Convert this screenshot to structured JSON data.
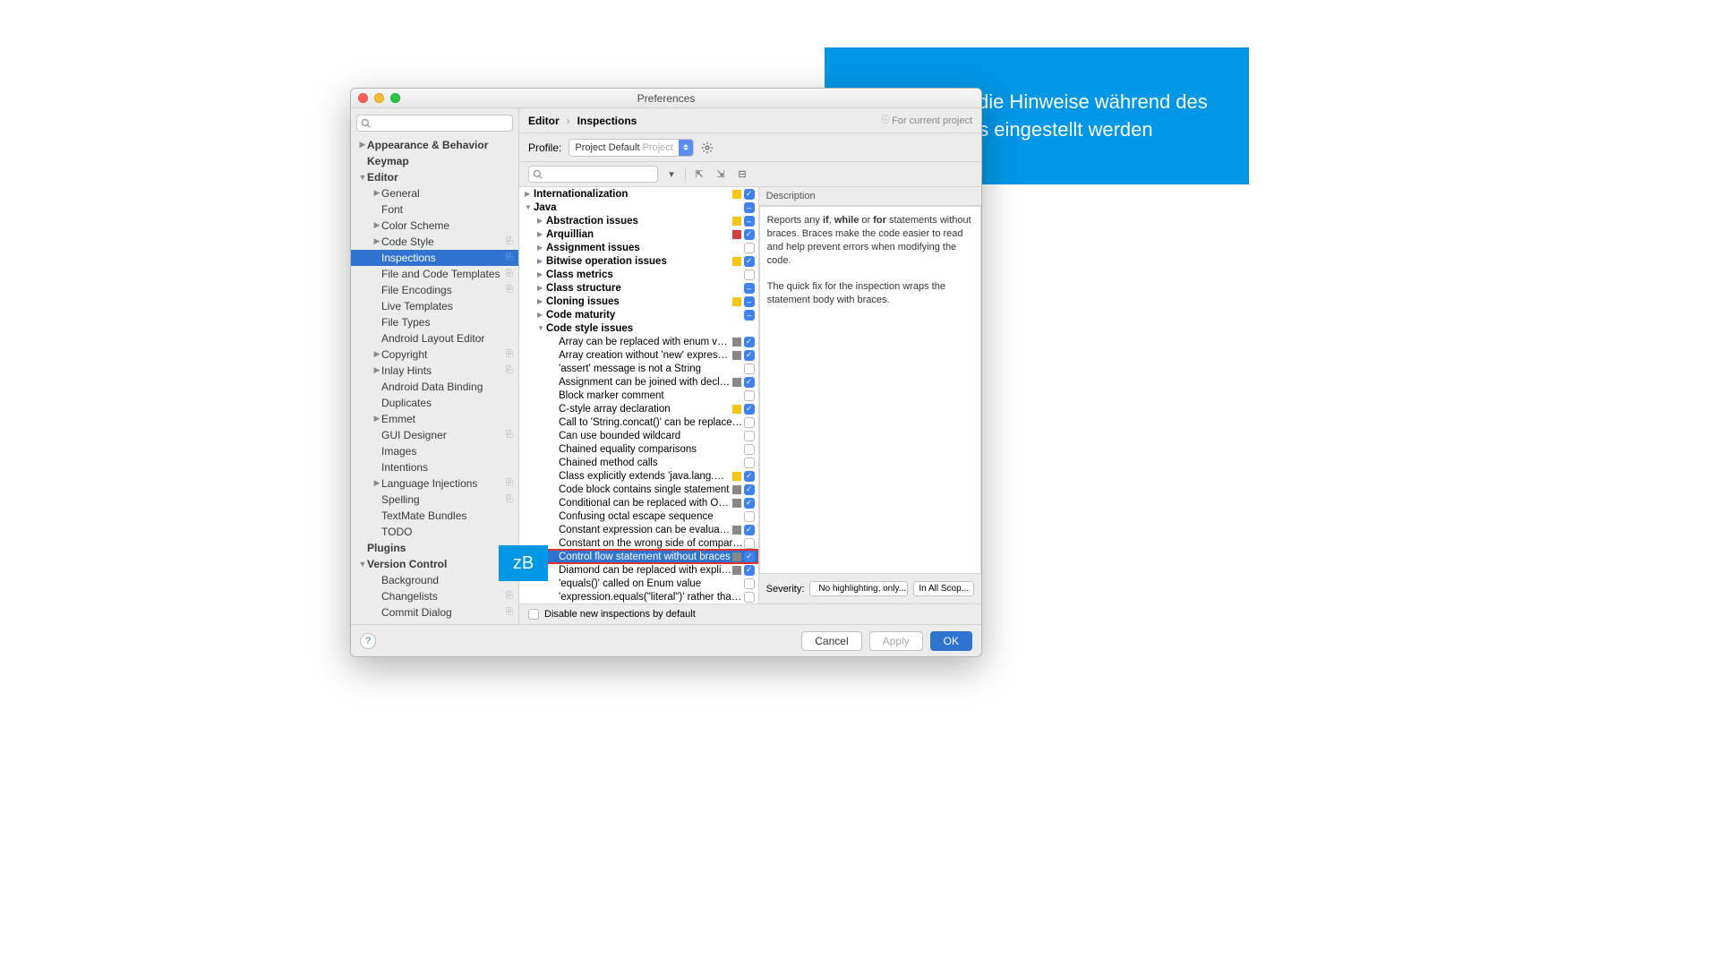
{
  "callouts": {
    "big_l1": "Hier können die Hinweise während des",
    "big_l2": "Codens eingestellt werden",
    "small": "zB"
  },
  "window": {
    "title": "Preferences",
    "crumb": {
      "a": "Editor",
      "b": "Inspections",
      "proj": "For current project"
    },
    "profile": {
      "label": "Profile:",
      "name": "Project Default",
      "scope": "Project"
    },
    "desc_head": "Description",
    "desc_body_html": "Reports any <b>if</b>, <b>while</b> or <b>for</b> statements without braces. Braces make the code easier to read and help prevent errors when modifying the code.<br><br>The quick fix for the inspection wraps the statement body with braces.",
    "severity": {
      "label": "Severity:",
      "value": "No highlighting, only...",
      "scope": "In All Scop..."
    },
    "disable_new": "Disable new inspections by default",
    "footer": {
      "cancel": "Cancel",
      "apply": "Apply",
      "ok": "OK"
    }
  },
  "sidebar": [
    {
      "l": "Appearance & Behavior",
      "d": 0,
      "a": ">",
      "b": true
    },
    {
      "l": "Keymap",
      "d": 0,
      "b": true
    },
    {
      "l": "Editor",
      "d": 0,
      "a": "v",
      "b": true
    },
    {
      "l": "General",
      "d": 1,
      "a": ">"
    },
    {
      "l": "Font",
      "d": 1
    },
    {
      "l": "Color Scheme",
      "d": 1,
      "a": ">"
    },
    {
      "l": "Code Style",
      "d": 1,
      "a": ">",
      "c": true
    },
    {
      "l": "Inspections",
      "d": 1,
      "sel": true,
      "c": true
    },
    {
      "l": "File and Code Templates",
      "d": 1,
      "c": true
    },
    {
      "l": "File Encodings",
      "d": 1,
      "c": true
    },
    {
      "l": "Live Templates",
      "d": 1
    },
    {
      "l": "File Types",
      "d": 1
    },
    {
      "l": "Android Layout Editor",
      "d": 1
    },
    {
      "l": "Copyright",
      "d": 1,
      "a": ">",
      "c": true
    },
    {
      "l": "Inlay Hints",
      "d": 1,
      "a": ">",
      "c": true
    },
    {
      "l": "Android Data Binding",
      "d": 1
    },
    {
      "l": "Duplicates",
      "d": 1
    },
    {
      "l": "Emmet",
      "d": 1,
      "a": ">"
    },
    {
      "l": "GUI Designer",
      "d": 1,
      "c": true
    },
    {
      "l": "Images",
      "d": 1
    },
    {
      "l": "Intentions",
      "d": 1
    },
    {
      "l": "Language Injections",
      "d": 1,
      "a": ">",
      "c": true
    },
    {
      "l": "Spelling",
      "d": 1,
      "c": true
    },
    {
      "l": "TextMate Bundles",
      "d": 1
    },
    {
      "l": "TODO",
      "d": 1
    },
    {
      "l": "Plugins",
      "d": 0,
      "b": true
    },
    {
      "l": "Version Control",
      "d": 0,
      "a": "v",
      "b": true,
      "c": true
    },
    {
      "l": "Background",
      "d": 1
    },
    {
      "l": "Changelists",
      "d": 1,
      "c": true
    },
    {
      "l": "Commit Dialog",
      "d": 1,
      "c": true
    }
  ],
  "inspections": [
    {
      "l": "Internationalization",
      "d": 0,
      "a": ">",
      "b": true,
      "sev": "#f5c518",
      "cb": "on"
    },
    {
      "l": "Java",
      "d": 0,
      "a": "v",
      "b": true,
      "cb": "mixed"
    },
    {
      "l": "Abstraction issues",
      "d": 1,
      "a": ">",
      "b": true,
      "sev": "#f5c518",
      "cb": "mixed"
    },
    {
      "l": "Arquillian",
      "d": 1,
      "a": ">",
      "b": true,
      "sev": "#d04040",
      "cb": "on"
    },
    {
      "l": "Assignment issues",
      "d": 1,
      "a": ">",
      "b": true,
      "cb": "off"
    },
    {
      "l": "Bitwise operation issues",
      "d": 1,
      "a": ">",
      "b": true,
      "sev": "#f5c518",
      "cb": "on"
    },
    {
      "l": "Class metrics",
      "d": 1,
      "a": ">",
      "b": true,
      "cb": "off"
    },
    {
      "l": "Class structure",
      "d": 1,
      "a": ">",
      "b": true,
      "cb": "mixed"
    },
    {
      "l": "Cloning issues",
      "d": 1,
      "a": ">",
      "b": true,
      "sev": "#f5c518",
      "cb": "mixed"
    },
    {
      "l": "Code maturity",
      "d": 1,
      "a": ">",
      "b": true,
      "cb": "mixed"
    },
    {
      "l": "Code style issues",
      "d": 1,
      "a": "v",
      "b": true
    },
    {
      "l": "Array can be replaced with enum values",
      "d": 2,
      "sev": "#888",
      "cb": "on"
    },
    {
      "l": "Array creation without 'new' expression",
      "d": 2,
      "sev": "#888",
      "cb": "on"
    },
    {
      "l": "'assert' message is not a String",
      "d": 2,
      "cb": "off"
    },
    {
      "l": "Assignment can be joined with declaration",
      "d": 2,
      "sev": "#888",
      "cb": "on"
    },
    {
      "l": "Block marker comment",
      "d": 2,
      "cb": "off"
    },
    {
      "l": "C-style array declaration",
      "d": 2,
      "sev": "#f5c518",
      "cb": "on"
    },
    {
      "l": "Call to 'String.concat()' can be replaced with",
      "d": 2,
      "cb": "off"
    },
    {
      "l": "Can use bounded wildcard",
      "d": 2,
      "cb": "off"
    },
    {
      "l": "Chained equality comparisons",
      "d": 2,
      "cb": "off"
    },
    {
      "l": "Chained method calls",
      "d": 2,
      "cb": "off"
    },
    {
      "l": "Class explicitly extends 'java.lang.Object'",
      "d": 2,
      "sev": "#f5c518",
      "cb": "on"
    },
    {
      "l": "Code block contains single statement",
      "d": 2,
      "sev": "#888",
      "cb": "on"
    },
    {
      "l": "Conditional can be replaced with Optional",
      "d": 2,
      "sev": "#888",
      "cb": "on"
    },
    {
      "l": "Confusing octal escape sequence",
      "d": 2,
      "cb": "off"
    },
    {
      "l": "Constant expression can be evaluated",
      "d": 2,
      "sev": "#888",
      "cb": "on"
    },
    {
      "l": "Constant on the wrong side of comparison",
      "d": 2,
      "cb": "off"
    },
    {
      "l": "Control flow statement without braces",
      "d": 2,
      "sev": "#888",
      "cb": "on",
      "sel": true,
      "hi": true
    },
    {
      "l": "Diamond can be replaced with explicit type",
      "d": 2,
      "sev": "#888",
      "cb": "on"
    },
    {
      "l": "'equals()' called on Enum value",
      "d": 2,
      "cb": "off"
    },
    {
      "l": "'expression.equals(\"literal\")' rather than '\"lit",
      "d": 2,
      "cb": "off"
    }
  ]
}
